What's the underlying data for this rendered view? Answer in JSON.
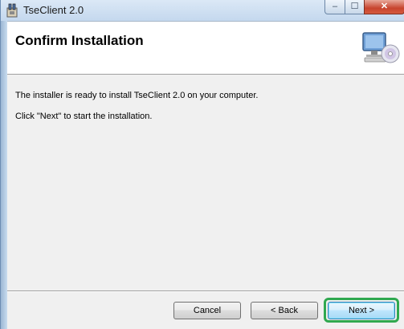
{
  "window": {
    "title": "TseClient 2.0",
    "icon": "installer-icon",
    "controls": {
      "minimize": "–",
      "maximize": "☐",
      "close": "✕"
    }
  },
  "header": {
    "title": "Confirm Installation",
    "icon": "computer-disc-icon"
  },
  "body": {
    "line1": "The installer is ready to install TseClient 2.0 on your computer.",
    "line2": "Click \"Next\" to start the installation."
  },
  "buttons": {
    "cancel": "Cancel",
    "back": "< Back",
    "next": "Next >"
  },
  "colors": {
    "highlight": "#2fa84f",
    "close_button": "#c7442e"
  }
}
